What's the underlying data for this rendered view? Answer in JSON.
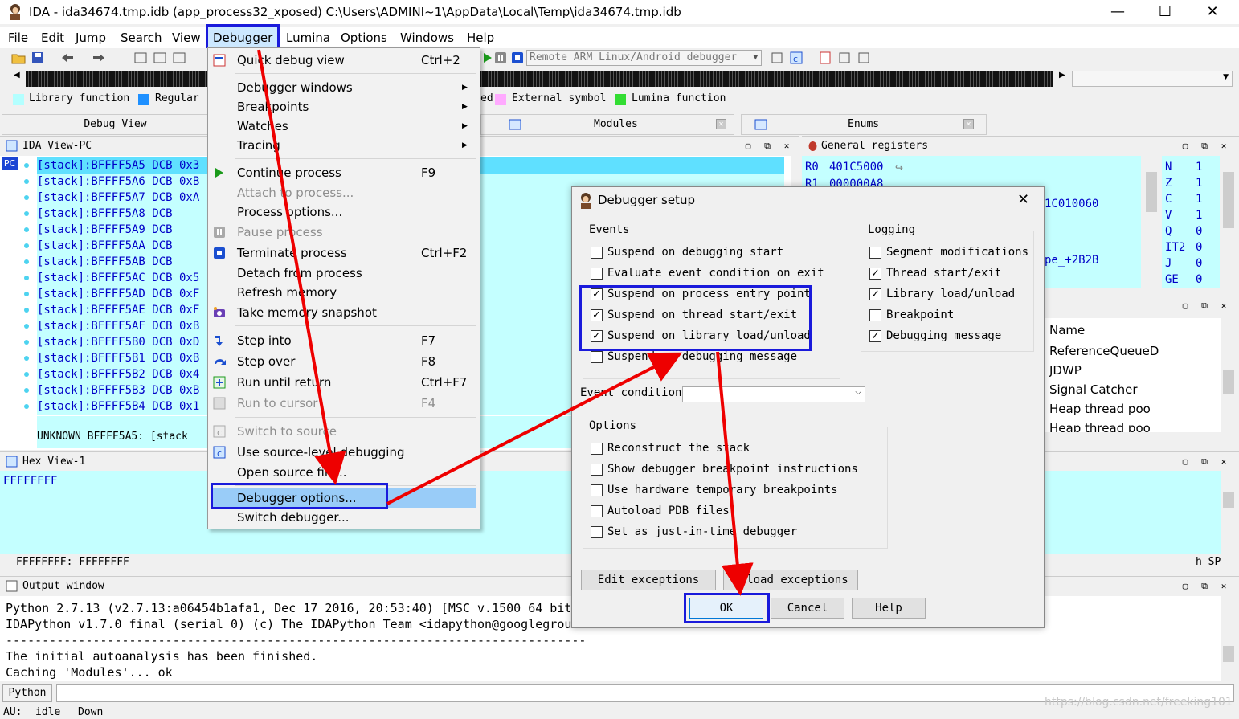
{
  "window": {
    "title": "IDA - ida34674.tmp.idb (app_process32_xposed) C:\\Users\\ADMINI~1\\AppData\\Local\\Temp\\ida34674.tmp.idb",
    "minimize": "—",
    "maximize": "☐",
    "close": "✕"
  },
  "menubar": [
    "File",
    "Edit",
    "Jump",
    "Search",
    "View",
    "Debugger",
    "Lumina",
    "Options",
    "Windows",
    "Help"
  ],
  "toolbar": {
    "debugger_select": "Remote ARM Linux/Android debugger"
  },
  "legend": [
    {
      "label": "Library function",
      "color": "#b3ffff"
    },
    {
      "label": "Regular",
      "color": "#1e90ff"
    },
    {
      "label": "ed",
      "color": null
    },
    {
      "label": "External symbol",
      "color": "#ffaaff"
    },
    {
      "label": "Lumina function",
      "color": "#33dd33"
    }
  ],
  "tabs": {
    "debug_view": "Debug View",
    "modules": "Modules",
    "enums": "Enums"
  },
  "ida_view": {
    "title": "IDA View-PC",
    "pc_label": "PC",
    "lines": [
      "[stack]:BFFFF5A5 DCB 0x3",
      "[stack]:BFFFF5A6 DCB 0xB",
      "[stack]:BFFFF5A7 DCB 0xA",
      "[stack]:BFFFF5A8 DCB",
      "[stack]:BFFFF5A9 DCB",
      "[stack]:BFFFF5AA DCB",
      "[stack]:BFFFF5AB DCB",
      "[stack]:BFFFF5AC DCB 0x5",
      "[stack]:BFFFF5AD DCB 0xF",
      "[stack]:BFFFF5AE DCB 0xF",
      "[stack]:BFFFF5AF DCB 0xB",
      "[stack]:BFFFF5B0 DCB 0xD",
      "[stack]:BFFFF5B1 DCB 0xB",
      "[stack]:BFFFF5B2 DCB 0x4",
      "[stack]:BFFFF5B3 DCB 0xB",
      "[stack]:BFFFF5B4 DCB 0x1"
    ],
    "status": "UNKNOWN BFFFF5A5: [stack"
  },
  "hex_view": {
    "title": "Hex View-1",
    "content": "FFFFFFFF",
    "status": "FFFFFFFF: FFFFFFFF",
    "status_right": "h SP)"
  },
  "registers": {
    "title": "General registers",
    "lines": [
      {
        "name": "R0",
        "value": "401C5000"
      },
      {
        "name": "R1",
        "value": "000000A8"
      }
    ],
    "extra": [
      "1C010060",
      "pe_+2B2B"
    ],
    "flags": [
      {
        "name": "N",
        "value": "1"
      },
      {
        "name": "Z",
        "value": "1"
      },
      {
        "name": "C",
        "value": "1"
      },
      {
        "name": "V",
        "value": "1"
      },
      {
        "name": "Q",
        "value": "0"
      },
      {
        "name": "IT2",
        "value": "0"
      },
      {
        "name": "J",
        "value": "0"
      },
      {
        "name": "GE",
        "value": "0"
      }
    ]
  },
  "threads": {
    "header": "Name",
    "items": [
      "ReferenceQueueD",
      "JDWP",
      "Signal Catcher",
      "Heap thread poo",
      "Heap thread poo"
    ]
  },
  "output": {
    "title": "Output window",
    "lines": [
      "Python 2.7.13 (v2.7.13:a06454b1afa1, Dec 17 2016, 20:53:40) [MSC v.1500 64 bit",
      "IDAPython v1.7.0 final (serial 0) (c) The IDAPython Team <idapython@googlegrou...",
      "--------------------------------------------------------------------------------",
      "The initial autoanalysis has been finished.",
      "Caching 'Modules'... ok"
    ],
    "python_button": "Python"
  },
  "statusbar": {
    "au_label": "AU:",
    "au_value": "idle",
    "direction": "Down"
  },
  "debugger_menu": {
    "items": [
      {
        "label": "Quick debug view",
        "shortcut": "Ctrl+2",
        "disabled": false
      },
      {
        "label": "Debugger windows",
        "shortcut": "",
        "submenu": true,
        "disabled": false
      },
      {
        "label": "Breakpoints",
        "shortcut": "",
        "submenu": true,
        "disabled": false
      },
      {
        "label": "Watches",
        "shortcut": "",
        "submenu": true,
        "disabled": false
      },
      {
        "label": "Tracing",
        "shortcut": "",
        "submenu": true,
        "disabled": false
      },
      {
        "label": "Continue process",
        "shortcut": "F9",
        "disabled": false
      },
      {
        "label": "Attach to process...",
        "shortcut": "",
        "disabled": true
      },
      {
        "label": "Process options...",
        "shortcut": "",
        "disabled": false
      },
      {
        "label": "Pause process",
        "shortcut": "",
        "disabled": true
      },
      {
        "label": "Terminate process",
        "shortcut": "Ctrl+F2",
        "disabled": false
      },
      {
        "label": "Detach from process",
        "shortcut": "",
        "disabled": false
      },
      {
        "label": "Refresh memory",
        "shortcut": "",
        "disabled": false
      },
      {
        "label": "Take memory snapshot",
        "shortcut": "",
        "disabled": false
      },
      {
        "label": "Step into",
        "shortcut": "F7",
        "disabled": false
      },
      {
        "label": "Step over",
        "shortcut": "F8",
        "disabled": false
      },
      {
        "label": "Run until return",
        "shortcut": "Ctrl+F7",
        "disabled": false
      },
      {
        "label": "Run to cursor",
        "shortcut": "F4",
        "disabled": true
      },
      {
        "label": "Switch to source",
        "shortcut": "",
        "disabled": true
      },
      {
        "label": "Use source-level debugging",
        "shortcut": "",
        "disabled": false
      },
      {
        "label": "Open source file...",
        "shortcut": "",
        "disabled": false
      },
      {
        "label": "Debugger options...",
        "shortcut": "",
        "disabled": false,
        "highlighted": true
      },
      {
        "label": "Switch debugger...",
        "shortcut": "",
        "disabled": false
      }
    ]
  },
  "dialog": {
    "title": "Debugger setup",
    "events_label": "Events",
    "events": [
      {
        "label": "Suspend on debugging start",
        "checked": false
      },
      {
        "label": "Evaluate event condition on exit",
        "checked": false
      },
      {
        "label": "Suspend on process entry point",
        "checked": true
      },
      {
        "label": "Suspend on thread start/exit",
        "checked": true
      },
      {
        "label": "Suspend on library load/unload",
        "checked": true
      },
      {
        "label": "Suspend on debugging message",
        "checked": false
      }
    ],
    "logging_label": "Logging",
    "logging": [
      {
        "label": "Segment modifications",
        "checked": false
      },
      {
        "label": "Thread start/exit",
        "checked": true
      },
      {
        "label": "Library load/unload",
        "checked": true
      },
      {
        "label": "Breakpoint",
        "checked": false
      },
      {
        "label": "Debugging message",
        "checked": true
      }
    ],
    "event_condition_label": "Event condition",
    "event_condition_value": "",
    "options_label": "Options",
    "options": [
      {
        "label": "Reconstruct the stack",
        "checked": false
      },
      {
        "label": "Show debugger breakpoint instructions",
        "checked": false
      },
      {
        "label": "Use hardware temporary breakpoints",
        "checked": false
      },
      {
        "label": "Autoload PDB files",
        "checked": false
      },
      {
        "label": "Set as just-in-time debugger",
        "checked": false
      }
    ],
    "edit_exceptions": "Edit exceptions",
    "reload_exceptions": "Reload exceptions",
    "ok": "OK",
    "cancel": "Cancel",
    "help": "Help",
    "check_mark": "✓"
  },
  "colors": {
    "highlight_box": "#1a1adb",
    "arrow": "#ee0000",
    "code_bg": "#c4ffff",
    "code_text": "#0000c8"
  },
  "watermark": "https://blog.csdn.net/freeking101"
}
